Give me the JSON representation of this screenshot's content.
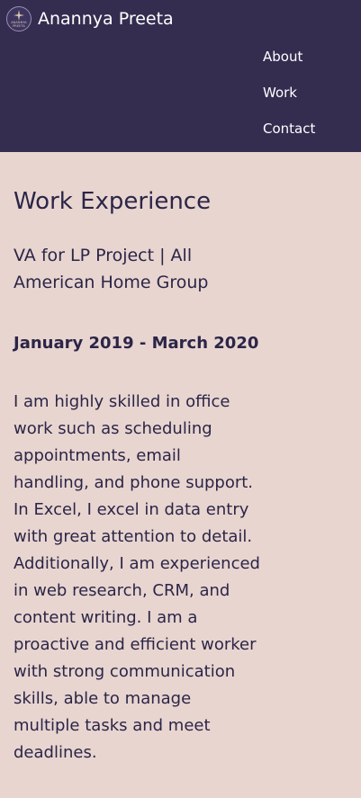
{
  "header": {
    "logo": {
      "icon": "sparkle-star-icon",
      "text_line1": "ANANNYA",
      "text_line2": "PREETA"
    },
    "brand_name": "Anannya Preeta",
    "nav_items": [
      "About",
      "Work",
      "Contact"
    ]
  },
  "main": {
    "title": "Work Experience",
    "role": "VA for LP Project | All American Home Group",
    "dates": "January 2019 - March 2020",
    "description": "I am highly skilled in office work such as scheduling appointments, email handling, and phone support. In Excel, I excel in data entry with great attention to detail. Additionally, I am experienced in web research, CRM, and content writing. I am a proactive and efficient worker with strong communication skills, able to manage multiple tasks and meet deadlines."
  },
  "colors": {
    "header_bg": "#342d50",
    "page_bg": "#e8d5d0",
    "text": "#2b2547",
    "logo_accent": "#d8c7a8"
  }
}
